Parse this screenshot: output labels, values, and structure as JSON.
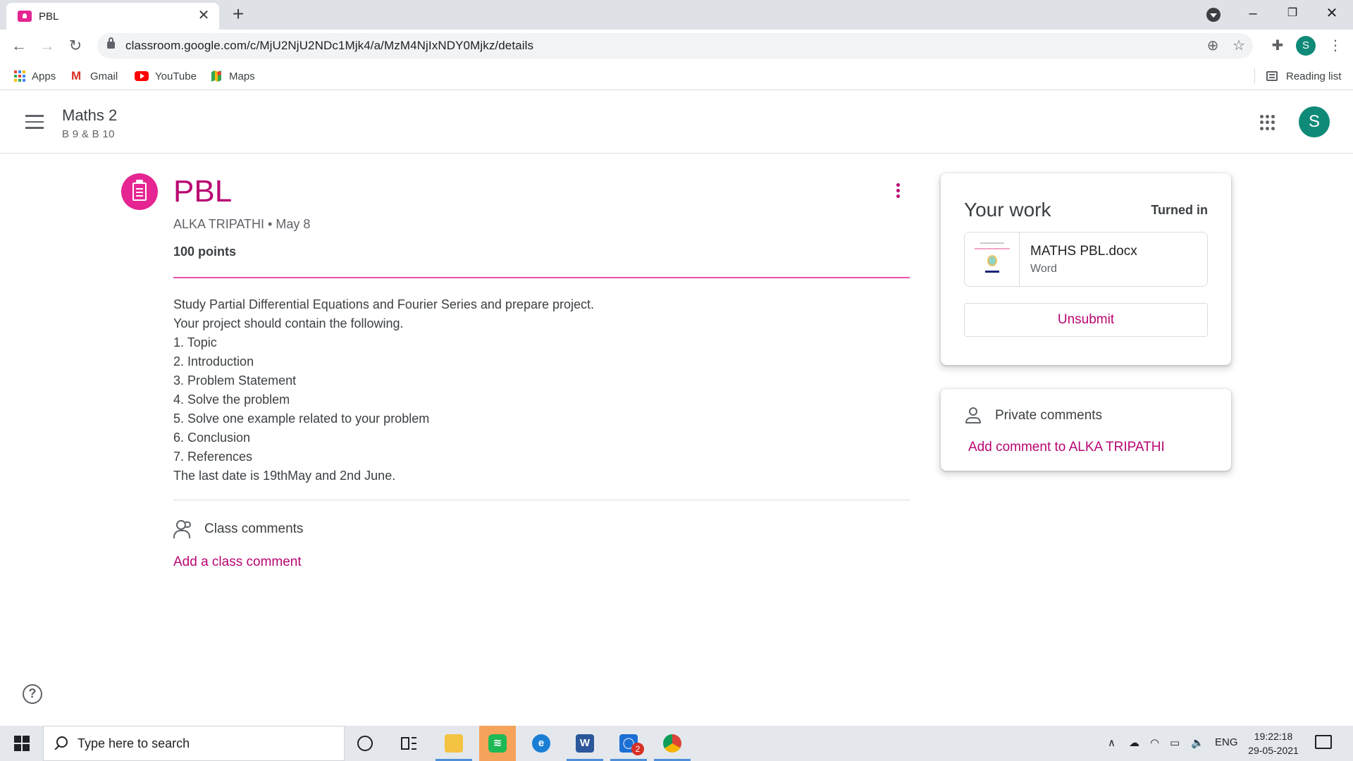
{
  "browser": {
    "tab_title": "PBL",
    "url": "classroom.google.com/c/MjU2NjU2NDc1Mjk4/a/MzM4NjIxNDY0Mjkz/details",
    "profile_initial": "S",
    "bookmarks": [
      {
        "label": "Apps",
        "icon": "apps-grid-icon"
      },
      {
        "label": "Gmail",
        "icon": "gmail-icon"
      },
      {
        "label": "YouTube",
        "icon": "youtube-icon"
      },
      {
        "label": "Maps",
        "icon": "maps-icon"
      }
    ],
    "reading_list": "Reading list"
  },
  "header": {
    "class_name": "Maths 2",
    "class_section": "B 9 & B 10",
    "avatar_initial": "S"
  },
  "assignment": {
    "title": "PBL",
    "meta": "ALKA TRIPATHI • May 8",
    "points": "100 points",
    "description": [
      "Study Partial Differential Equations and Fourier Series and prepare project.",
      "Your project should contain the following.",
      "1. Topic",
      "2. Introduction",
      "3. Problem Statement",
      "4. Solve the problem",
      "5. Solve one example related to your problem",
      "6. Conclusion",
      "7. References",
      "The last date is 19thMay and 2nd June."
    ],
    "class_comments_label": "Class comments",
    "add_class_comment": "Add a class comment",
    "accent_color": "#b80672"
  },
  "your_work": {
    "title": "Your work",
    "status": "Turned in",
    "file": {
      "name": "MATHS PBL.docx",
      "type": "Word"
    },
    "unsubmit_label": "Unsubmit"
  },
  "private_comments": {
    "label": "Private comments",
    "add_label": "Add comment to ALKA TRIPATHI"
  },
  "taskbar": {
    "search_placeholder": "Type here to search",
    "apps": [
      {
        "name": "file-explorer-icon",
        "color": "#f5c342"
      },
      {
        "name": "spotify-icon",
        "color": "#1db954"
      },
      {
        "name": "edge-icon",
        "color": "#1a7fd4"
      },
      {
        "name": "word-icon",
        "color": "#2b579a"
      },
      {
        "name": "whatsapp-icon",
        "color": "#1c6fd4",
        "badge": "2"
      },
      {
        "name": "chrome-icon",
        "color": "#db4437"
      }
    ],
    "language": "ENG",
    "time": "19:22:18",
    "date": "29-05-2021"
  }
}
